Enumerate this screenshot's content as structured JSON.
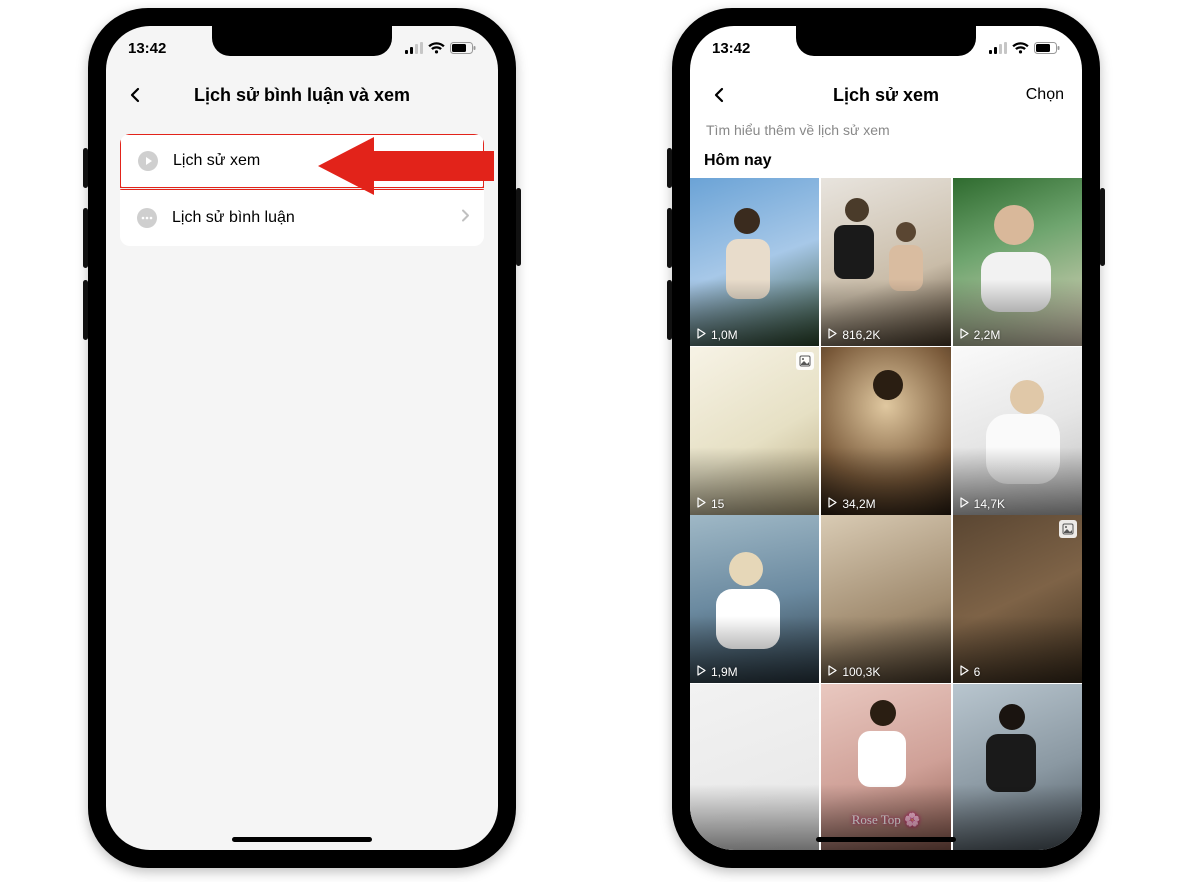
{
  "statusbar": {
    "time": "13:42"
  },
  "phone_left": {
    "header_title": "Lịch sử bình luận và xem",
    "menu": {
      "watch_history": "Lịch sử xem",
      "comment_history": "Lịch sử bình luận"
    }
  },
  "phone_right": {
    "header_title": "Lịch sử xem",
    "select_label": "Chọn",
    "info_text": "Tìm hiểu thêm về lịch sử xem",
    "section_today": "Hôm nay",
    "videos": [
      {
        "views": "1,0M",
        "image_badge": false
      },
      {
        "views": "816,2K",
        "image_badge": false
      },
      {
        "views": "2,2M",
        "image_badge": false
      },
      {
        "views": "15",
        "image_badge": true
      },
      {
        "views": "34,2M",
        "image_badge": false
      },
      {
        "views": "14,7K",
        "image_badge": false
      },
      {
        "views": "1,9M",
        "image_badge": false
      },
      {
        "views": "100,3K",
        "image_badge": false
      },
      {
        "views": "6",
        "image_badge": true
      },
      {
        "views": "",
        "image_badge": false
      },
      {
        "views": "",
        "image_badge": false
      },
      {
        "views": "",
        "image_badge": false
      }
    ],
    "overlay_text": {
      "rose_top": "Rose Top"
    }
  }
}
